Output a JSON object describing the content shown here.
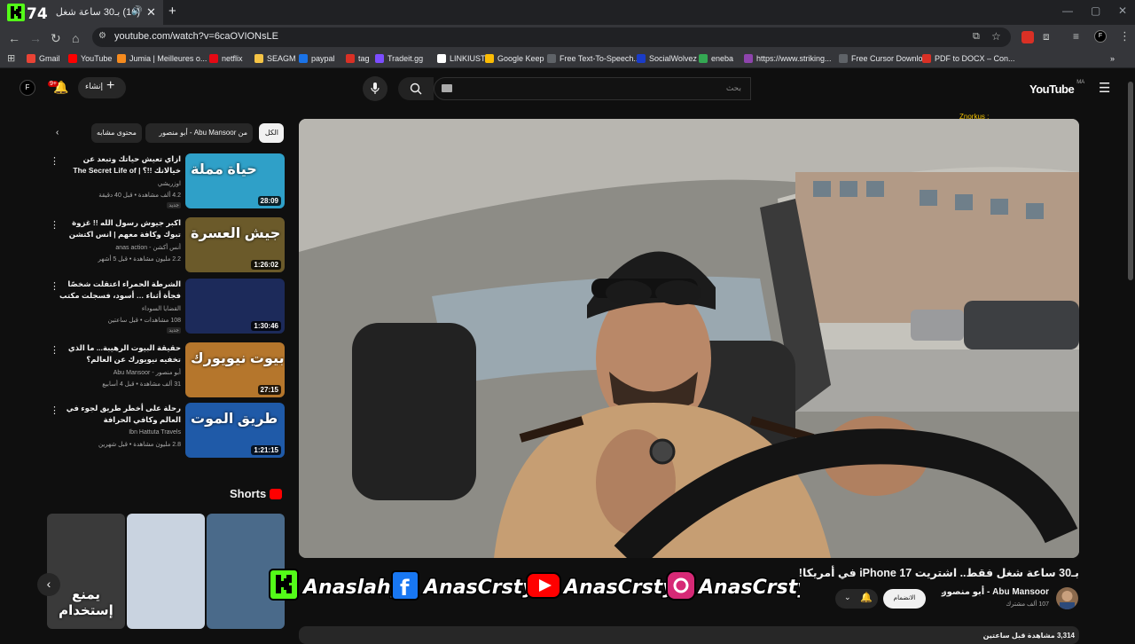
{
  "browser": {
    "tab_title": "(16) بـ30 ساعة شغل فقط...",
    "url": "youtube.com/watch?v=6caOVIONsLE",
    "bookmarks": [
      "Gmail",
      "YouTube",
      "Jumia | Meilleures o...",
      "netflix",
      "SEAGM",
      "paypal",
      "tag",
      "Tradeit.gg",
      "LINKIUST",
      "Google Keep",
      "Free Text-To-Speech...",
      "SocialWolvez",
      "eneba",
      "https://www.striking...",
      "Free Cursor Downlo...",
      "PDF to DOCX – Con..."
    ],
    "bookmark_colors": [
      "#ea4335",
      "#ff0000",
      "#f68b1e",
      "#e50914",
      "#f6c445",
      "#1a73e8",
      "#d93025",
      "#7c4dff",
      "#ffffff",
      "#fbbc04",
      "#5f6368",
      "#1a3cc8",
      "#34a853",
      "#8e44ad",
      "#5f6368",
      "#d93025"
    ]
  },
  "header": {
    "create_label": "إنشاء",
    "notif_count": "9+",
    "search_placeholder": "بحث",
    "avatar_letter": "F",
    "logo_text": "YouTube",
    "logo_region": "MA"
  },
  "chips": {
    "all": "الكل",
    "from_channel": "من Abu Mansoor - أبو منصور",
    "related": "محتوى مشابه"
  },
  "recommendations": [
    {
      "title": "ازاي تعيش حياتك وتبعد عن خيالاتك !!؟ | The Secret Life of Walter Mitty",
      "channel": "اوزريشي",
      "meta": "4.2 ألف مشاهدة • قبل 40 دقيقة",
      "badge": "جديد",
      "duration": "28:09",
      "thumb_color": "#2fa0c8",
      "thumb_text": "حياة مملة"
    },
    {
      "title": "اكبر جيوش رسول الله !! غزوة تبوك وكافة معهم | انس اكتشن",
      "channel": "أنس أكشن - anas action",
      "meta": "2.2 مليون مشاهدة • قبل 5 أشهر",
      "badge": "",
      "duration": "1:26:02",
      "thumb_color": "#6b5a2a",
      "thumb_text": "جيش العسرة"
    },
    {
      "title": "الشرطة الحمراء اعتقلت شخصًا فجأة أثناء … أسود، فسجلت مكتب التحقيقات الفيدرالي …",
      "channel": "القضايا السوداء",
      "meta": "108 مشاهدات • قبل ساعتين",
      "badge": "جديد",
      "duration": "1:30:46",
      "thumb_color": "#1c2a5a",
      "thumb_text": ""
    },
    {
      "title": "حقيقة البيوت الرهيبة... ما الذي تخفيه نيويورك عن العالم؟",
      "channel": "أبو منصور - Abu Mansoor",
      "meta": "31 ألف مشاهدة • قبل 4 أسابيع",
      "badge": "",
      "duration": "27:15",
      "thumb_color": "#b5762c",
      "thumb_text": "بيوت نيويورك"
    },
    {
      "title": "رحلة على أخطر طريق لجوء في العالم وكافي الحرافة",
      "channel": "Ibn Hattuta Travels",
      "meta": "2.8 مليون مشاهدة • قبل شهرين",
      "badge": "",
      "duration": "1:21:15",
      "thumb_color": "#1f5aa8",
      "thumb_text": "طريق الموت"
    }
  ],
  "shorts": {
    "title": "Shorts",
    "items": [
      {
        "caption": "يمنع إستخدام",
        "color": "#3a3a3a"
      },
      {
        "caption": "",
        "color": "#c9d3e0"
      },
      {
        "caption": "",
        "color": "#4a6a8a"
      }
    ]
  },
  "video": {
    "overlay_tag": "Znorkus :",
    "title": "بـ30 ساعة شغل فقط.. اشتريت iPhone 17 في أمريكا!",
    "channel_name": "Abu Mansoor - أبو منصور",
    "subscribers": "107 ألف مشترك",
    "join_label": "الانضمام",
    "views_label": "3,314 مشاهدة قبل ساعتين"
  },
  "banner": {
    "handles": [
      "Anaslahya",
      "AnasCrstyle",
      "AnasCrstyle",
      "AnasCrstyle"
    ]
  }
}
